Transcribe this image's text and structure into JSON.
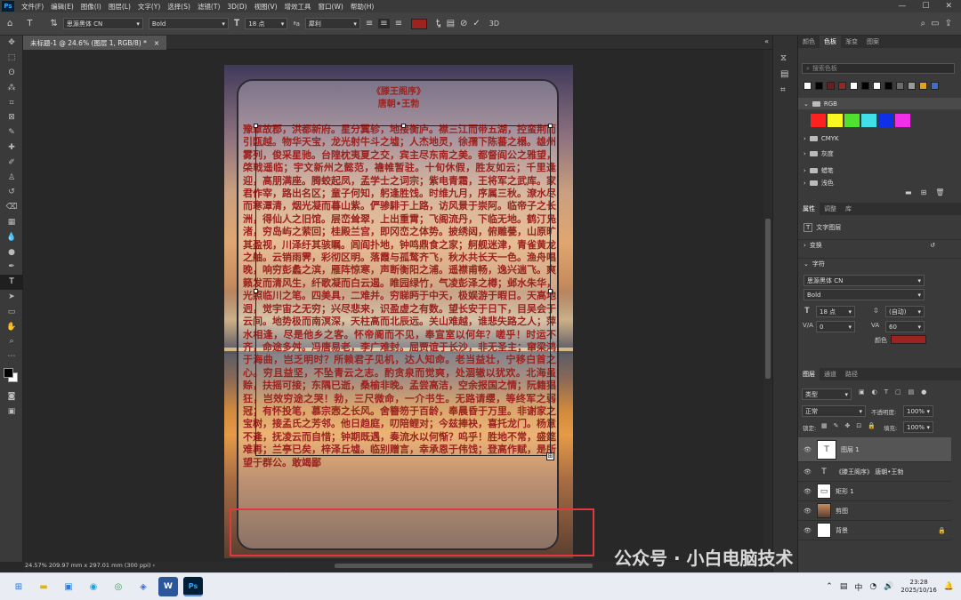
{
  "menu": [
    "文件(F)",
    "编辑(E)",
    "图像(I)",
    "图层(L)",
    "文字(Y)",
    "选择(S)",
    "滤镜(T)",
    "3D(D)",
    "视图(V)",
    "增效工具",
    "窗口(W)",
    "帮助(H)"
  ],
  "window_controls": {
    "min": "—",
    "max": "☐",
    "close": "✕"
  },
  "options": {
    "font_family": "思源黑体 CN",
    "font_style": "Bold",
    "font_size": "18 点",
    "aa_label": "ªa",
    "antialias": "犀利",
    "color": "#9b2320",
    "mode3d": "3D"
  },
  "doc_tab": {
    "title": "未标题-1 @ 24.6% (图层 1, RGB/8) *",
    "close": "×"
  },
  "canvas": {
    "poem_title": "《滕王阁序》",
    "poem_author": "唐朝•王勃",
    "poem_text": "豫章故郡，洪都新府。星分翼轸，地接衡庐。襟三江而带五湖，控蛮荆而引瓯越。物华天宝，龙光射牛斗之墟；人杰地灵，徐孺下陈蕃之榻。雄州雾列，俊采星驰。台隍枕夷夏之交，宾主尽东南之美。都督阎公之雅望，棨戟遥临；宇文新州之懿范，襜帷暂驻。十旬休假，胜友如云；千里逢迎，高朋满座。腾蛟起凤，孟学士之词宗；紫电青霜，王将军之武库。家君作宰，路出名区；童子何知，躬逢胜饯。时维九月，序属三秋。潦水尽而寒潭清，烟光凝而暮山紫。俨骖騑于上路，访风景于崇阿。临帝子之长洲，得仙人之旧馆。层峦耸翠，上出重霄；飞阁流丹，下临无地。鹤汀凫渚，穷岛屿之萦回；桂殿兰宫，即冈峦之体势。披绣闼，俯雕甍，山原旷其盈视，川泽纡其骇瞩。闾阎扑地，钟鸣鼎食之家；舸舰迷津，青雀黄龙之舳。云销雨霁，彩彻区明。落霞与孤鹜齐飞，秋水共长天一色。渔舟唱晚，响穷彭蠡之滨，雁阵惊寒，声断衡阳之浦。遥襟甫畅，逸兴遄飞。爽籁发而清风生，纤歌凝而白云遏。睢园绿竹，气凌彭泽之樽；邺水朱华，光照临川之笔。四美具，二难并。穷睇眄于中天，极娱游于暇日。天高地迥，觉宇宙之无穷；兴尽悲来，识盈虚之有数。望长安于日下，目吴会于云间。地势极而南溟深，天柱高而北辰远。关山难越，谁悲失路之人；萍水相逢，尽是他乡之客。怀帝阍而不见，奉宣室以何年？嗟乎！时运不齐，命途多舛。冯唐易老，李广难封。屈贾谊于长沙，非无圣主；窜梁鸿于海曲，岂乏明时？所赖君子见机，达人知命。老当益壮，宁移白首之心。穷且益坚，不坠青云之志。酌贪泉而觉爽，处涸辙以犹欢。北海虽赊，扶摇可接；东隅已逝，桑榆非晚。孟尝高洁，空余报国之情；阮籍猖狂，岂效穷途之哭！勃，三尺微命，一介书生。无路请缨，等终军之弱冠；有怀投笔，慕宗悫之长风。舍簪笏于百龄，奉晨昏于万里。非谢家之宝树，接孟氏之芳邻。他日趋庭，叨陪鲤对；今兹捧袂，喜托龙门。杨意不逢，抚凌云而自惜；钟期既遇，奏流水以何惭？呜乎！胜地不常，盛筵难再；兰亭已矣，梓泽丘墟。临别赠言，幸承恩于伟饯；登高作赋，是所望于群公。敢竭鄙"
  },
  "status": "24.57%  209.97 mm x 297.01 mm (300 ppi)  ›",
  "color_panel": {
    "tabs": [
      "颜色",
      "色板",
      "渐变",
      "图案"
    ],
    "search_placeholder": "搜索色板",
    "group_rgb": "RGB",
    "groups": [
      "CMYK",
      "灰度",
      "蜡笔",
      "浅色"
    ],
    "recent": [
      "#ffffff",
      "#000000",
      "#6b1e1e",
      "#9b2320",
      "#ffffff",
      "#000000",
      "#ffffff",
      "#000000",
      "#6b6b6b",
      "#9a9a9a",
      "#e0a020",
      "#3a6fd0"
    ],
    "rgb": [
      "#ff2020",
      "#f8f820",
      "#50e030",
      "#40e0e8",
      "#1030e8",
      "#f030e8"
    ]
  },
  "properties": {
    "tabs": [
      "属性",
      "调整",
      "库"
    ],
    "kind": "文字图层",
    "transform": "变换",
    "char": "字符",
    "font": "思源黑体 CN",
    "style": "Bold",
    "size": "18 点",
    "leading": "(自动)",
    "kerning": "0",
    "tracking": "60",
    "color_label": "颜色"
  },
  "layers": {
    "tabs": [
      "图层",
      "通道",
      "路径"
    ],
    "search_placeholder": "类型",
    "blend": "正常",
    "opacity_label": "不透明度:",
    "opacity": "100%",
    "lock_label": "锁定:",
    "fill_label": "填充:",
    "fill": "100%",
    "items": [
      {
        "name": "图层 1",
        "thumb": "T"
      },
      {
        "name": "《滕王阁序》 唐朝•王勃",
        "thumb": "T"
      },
      {
        "name": "矩形 1",
        "thumb": "▭"
      },
      {
        "name": "剪图",
        "thumb": "▦"
      },
      {
        "name": "背景",
        "thumb": ""
      }
    ]
  },
  "taskbar": {
    "time": "23:28",
    "date": "2025/10/16",
    "lang": "中"
  },
  "watermark": "公众号 · 小白电脑技术"
}
